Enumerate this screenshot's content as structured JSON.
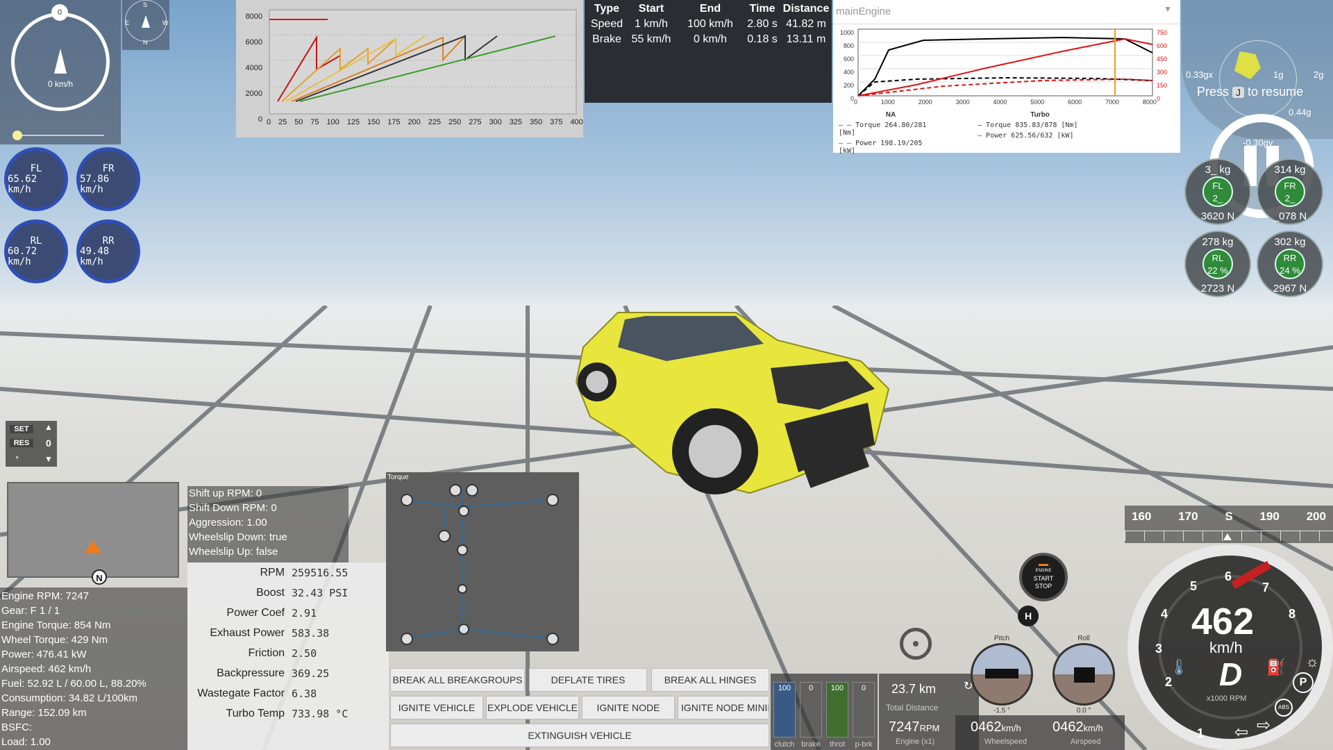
{
  "compass": {
    "speed": "0 km/h",
    "top_badge": "0",
    "rose": {
      "n": "N",
      "s": "S",
      "e": "E",
      "w": "W"
    }
  },
  "wheels": [
    {
      "pos": "FL",
      "speed": "65.62 km/h"
    },
    {
      "pos": "FR",
      "speed": "57.86 km/h"
    },
    {
      "pos": "RL",
      "speed": "60.72 km/h"
    },
    {
      "pos": "RR",
      "speed": "49.48 km/h"
    }
  ],
  "accel_chart": {
    "y_ticks": [
      "8000",
      "6000",
      "4000",
      "2000",
      "0"
    ],
    "x_ticks": [
      "0",
      "25",
      "50",
      "75",
      "100",
      "125",
      "150",
      "175",
      "200",
      "225",
      "250",
      "275",
      "300",
      "325",
      "350",
      "375",
      "400"
    ]
  },
  "perf_table": {
    "headers": [
      "Type",
      "Start",
      "End",
      "Time",
      "Distance"
    ],
    "rows": [
      [
        "Speed",
        "1 km/h",
        "100 km/h",
        "2.80 s",
        "41.82 m"
      ],
      [
        "Brake",
        "55 km/h",
        "0 km/h",
        "0.18 s",
        "13.11 m"
      ]
    ]
  },
  "engine_graph": {
    "title": "mainEngine",
    "y_left_ticks": [
      "1000",
      "800",
      "600",
      "400",
      "200",
      "0"
    ],
    "y_right_ticks": [
      "750",
      "600",
      "450",
      "300",
      "150",
      "0"
    ],
    "x_ticks": [
      "0",
      "1000",
      "2000",
      "3000",
      "4000",
      "5000",
      "6000",
      "7000",
      "8000"
    ],
    "legend": {
      "na_title": "NA",
      "turbo_title": "Turbo",
      "na_torque": "Torque 264.80/281 [Nm]",
      "na_power": "Power  198.19/205 [kW]",
      "turbo_torque": "Torque 835.83/878 [Nm]",
      "turbo_power": "Power  625.56/632 [kW]"
    }
  },
  "gforce": {
    "left": "0.33gx",
    "right1": "1g",
    "right2": "2g",
    "bottom": "0.44g",
    "mid": "-0.30gy",
    "press": "Press",
    "key": "J",
    "resume": "to resume"
  },
  "tire_weights": [
    {
      "pos": "FL",
      "weight": "3_ kg",
      "pct": "2_",
      "force": "3620 N"
    },
    {
      "pos": "FR",
      "weight": "314 kg",
      "pct": "2_",
      "force": "_078 N"
    },
    {
      "pos": "RL",
      "weight": "278 kg",
      "pct": "22 %",
      "force": "2723 N"
    },
    {
      "pos": "RR",
      "weight": "302 kg",
      "pct": "24 %",
      "force": "2967 N"
    }
  ],
  "cruise": {
    "set": "SET",
    "res": "RES",
    "value": "0"
  },
  "minimap": {
    "marker": "N"
  },
  "shift_info": [
    "Shift up RPM: 0",
    "Shift Down RPM: 0",
    "Aggression: 1.00",
    "Wheelslip Down: true",
    "Wheelslip Up: false"
  ],
  "engine_stats": [
    "Engine RPM: 7247",
    "Gear: F 1 / 1",
    "Engine Torque: 854 Nm",
    "Wheel Torque: 429 Nm",
    "Power: 476.41 kW",
    "Airspeed: 462 km/h",
    "Fuel: 52.92 L / 60.00 L, 88.20%",
    "Consumption: 34.82 L/100km",
    "Range: 152.09 km",
    "BSFC:",
    "Load: 1.00"
  ],
  "turbo_params": [
    {
      "k": "RPM",
      "v": "259516.55"
    },
    {
      "k": "Boost",
      "v": "32.43 PSI"
    },
    {
      "k": "Power Coef",
      "v": "2.91"
    },
    {
      "k": "Exhaust Power",
      "v": "583.38"
    },
    {
      "k": "Friction",
      "v": "2.50"
    },
    {
      "k": "Backpressure",
      "v": "369.25"
    },
    {
      "k": "Wastegate Factor",
      "v": "6.38"
    },
    {
      "k": "Turbo Temp",
      "v": "733.98 °C"
    }
  ],
  "powertrain": {
    "title": "Torque"
  },
  "buttons": {
    "row1": [
      "BREAK ALL BREAKGROUPS",
      "DEFLATE TIRES",
      "BREAK ALL HINGES"
    ],
    "row2": [
      "IGNITE VEHICLE",
      "EXPLODE VEHICLE",
      "IGNITE NODE",
      "IGNITE NODE MINIM"
    ],
    "row3": [
      "EXTINGUISH VEHICLE"
    ]
  },
  "pedals": [
    {
      "label": "clutch",
      "value": "100",
      "level": 1.0,
      "color": "#3a5a86"
    },
    {
      "label": "brake",
      "value": "0",
      "level": 0.0,
      "color": "#6a2a2a"
    },
    {
      "label": "throt",
      "value": "100",
      "level": 1.0,
      "color": "#3f6e2f"
    },
    {
      "label": "p-brk",
      "value": "0",
      "level": 0.0,
      "color": "#6a5a2a"
    }
  ],
  "trip": {
    "distance": "23.7 km",
    "distance_label": "Total Distance",
    "rpm": "7247",
    "rpm_unit": "RPM",
    "rpm_label": "Engine (x1)",
    "wheelspeed": "0462",
    "wheelspeed_unit": "km/h",
    "wheelspeed_label": "Wheelspeed",
    "airspeed": "0462",
    "airspeed_unit": "km/h",
    "airspeed_label": "Airspeed"
  },
  "attitude": {
    "pitch_label": "Pitch",
    "pitch": "-1.5 °",
    "roll_label": "Roll",
    "roll": "0.0 °"
  },
  "engine_button": {
    "l1": "ENGINE",
    "l2": "START",
    "l3": "STOP"
  },
  "hazard": "H",
  "compass_strip": [
    "160",
    "170",
    "S",
    "190",
    "200"
  ],
  "gauge": {
    "speed": "462",
    "unit": "km/h",
    "gear": "D",
    "rpm_unit": "x1000 RPM",
    "ticks": [
      "1",
      "2",
      "3",
      "4",
      "5",
      "6",
      "7",
      "8"
    ],
    "park": "P",
    "abs": "ABS"
  }
}
